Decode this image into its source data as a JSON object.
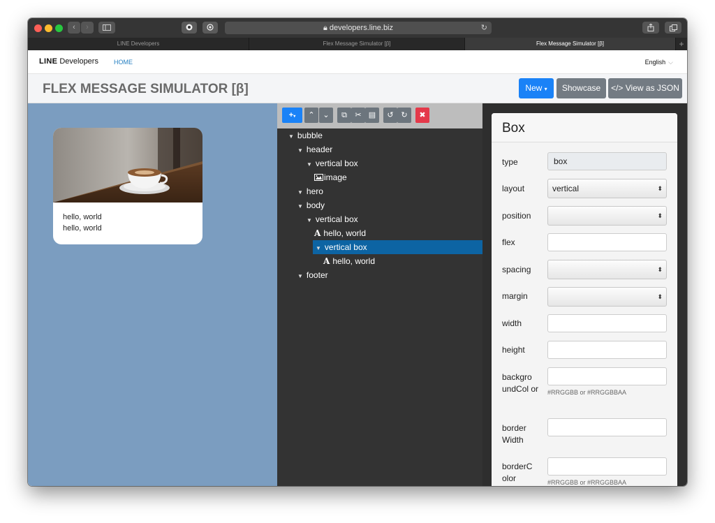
{
  "browser": {
    "url": "developers.line.biz",
    "tabs": [
      {
        "label": "LINE Developers",
        "active": false
      },
      {
        "label": "Flex Message Simulator [β]",
        "active": false
      },
      {
        "label": "Flex Message Simulator [β]",
        "active": true
      }
    ],
    "new_tab_label": "+"
  },
  "nav": {
    "logo_bold": "LINE",
    "logo_rest": "Developers",
    "home": "HOME",
    "language": "English"
  },
  "header": {
    "title": "FLEX MESSAGE SIMULATOR [β]",
    "new_button": "New",
    "showcase_button": "Showcase",
    "json_button": "</> View as JSON"
  },
  "preview": {
    "text1": "hello, world",
    "text2": "hello, world"
  },
  "tree": {
    "items": [
      {
        "label": "bubble",
        "kind": "node"
      },
      {
        "label": "header",
        "kind": "node"
      },
      {
        "label": "vertical box",
        "kind": "node"
      },
      {
        "label": "image",
        "kind": "image"
      },
      {
        "label": "hero",
        "kind": "node"
      },
      {
        "label": "body",
        "kind": "node"
      },
      {
        "label": "vertical box",
        "kind": "node"
      },
      {
        "label": "hello, world",
        "kind": "text"
      },
      {
        "label": "vertical box",
        "kind": "node",
        "selected": true
      },
      {
        "label": "hello, world",
        "kind": "text"
      },
      {
        "label": "footer",
        "kind": "node"
      }
    ]
  },
  "props": {
    "title": "Box",
    "type_label": "type",
    "type_value": "box",
    "layout_label": "layout",
    "layout_value": "vertical",
    "position_label": "position",
    "flex_label": "flex",
    "spacing_label": "spacing",
    "margin_label": "margin",
    "width_label": "width",
    "height_label": "height",
    "bgcolor_label": "backgro undCol or",
    "bgcolor_hint": "#RRGGBB or #RRGGBBAA",
    "borderwidth_label": "border Width",
    "bordercolor_label": "borderC olor",
    "bordercolor_hint": "#RRGGBB or #RRGGBBAA"
  }
}
